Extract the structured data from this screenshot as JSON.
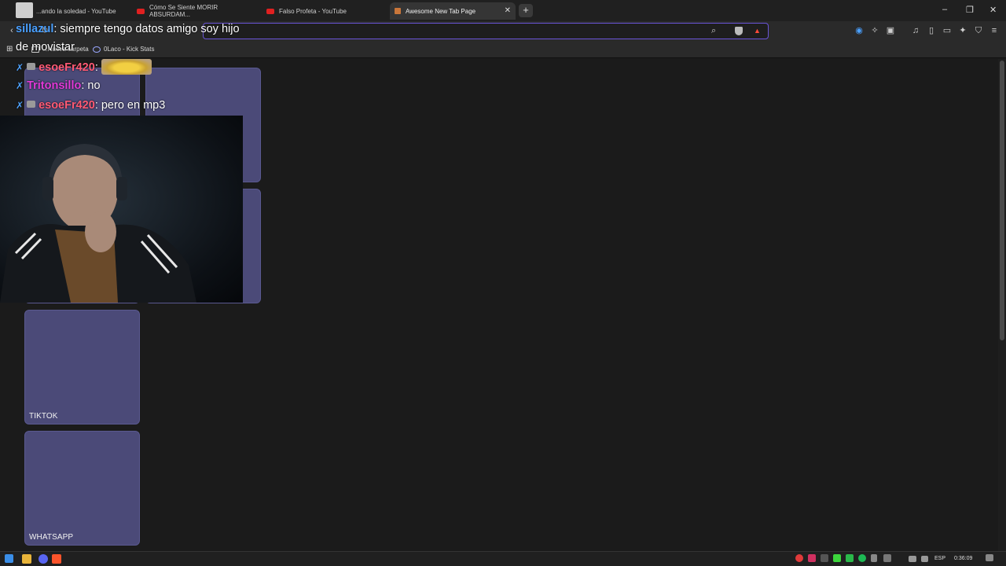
{
  "tabs": [
    {
      "title": "...ando la soledad - YouTube",
      "active": false
    },
    {
      "title": "Cómo Se Siente MORIR ABSURDAM...",
      "active": false
    },
    {
      "title": "Falso Profeta - YouTube",
      "active": false
    },
    {
      "title": "Awesome New Tab Page",
      "active": true
    }
  ],
  "new_tab_symbol": "+",
  "window_controls": {
    "minimize": "–",
    "restore": "❐",
    "close": "✕"
  },
  "bookmarks": [
    {
      "label": "...Nueva carpeta"
    },
    {
      "label": "0Laco - Kick Stats"
    }
  ],
  "tiles": [
    {
      "label": ""
    },
    {
      "label": ""
    },
    {
      "label": ""
    },
    {
      "label": ""
    },
    {
      "label": "TIKTOK"
    },
    {
      "label": "WHATSAPP"
    }
  ],
  "chat": [
    {
      "user": "sillazul",
      "message": ": siempre tengo datos amigo soy hijo"
    },
    {
      "user": "",
      "message": "de movistar"
    },
    {
      "user": "esoeFr420",
      "message": ": "
    },
    {
      "user": "Tritonsillo",
      "message": ": no"
    },
    {
      "user": "esoeFr420",
      "message": ": pero en mp3"
    }
  ],
  "taskbar": {
    "language": "ESP",
    "time": "0:36:09"
  },
  "colors": {
    "accent": "#6a55d8",
    "tile": "#4b4a78",
    "background": "#1b1b1b"
  }
}
